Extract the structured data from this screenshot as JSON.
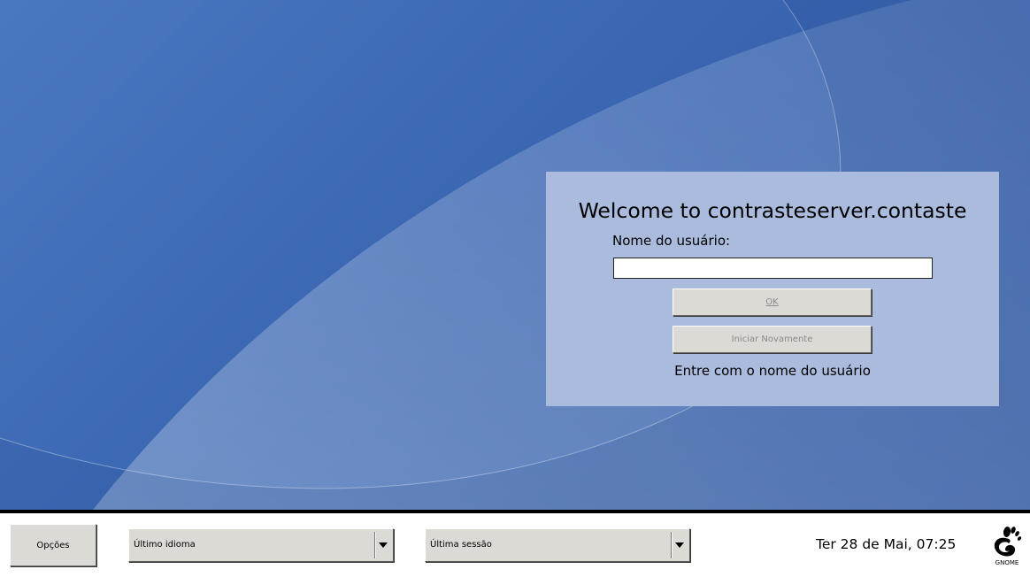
{
  "login": {
    "welcome": "Welcome to contrasteserver.contaste",
    "username_label": "Nome do usuário:",
    "username_value": "",
    "ok_label": "OK",
    "restart_label": "Iniciar Novamente",
    "hint": "Entre com o nome do usuário"
  },
  "bottom_bar": {
    "options_label": "Opções",
    "language_selected": "Último idioma",
    "session_selected": "Última sessão",
    "clock": "Ter 28 de Mai, 07:25",
    "logo_text": "GNOME"
  },
  "colors": {
    "desktop_blue": "#3a66b2",
    "panel_bg": "#aabbdd",
    "button_bg": "#dcdad5"
  },
  "icons": [
    "chevron-down-icon",
    "gnome-foot-icon"
  ]
}
